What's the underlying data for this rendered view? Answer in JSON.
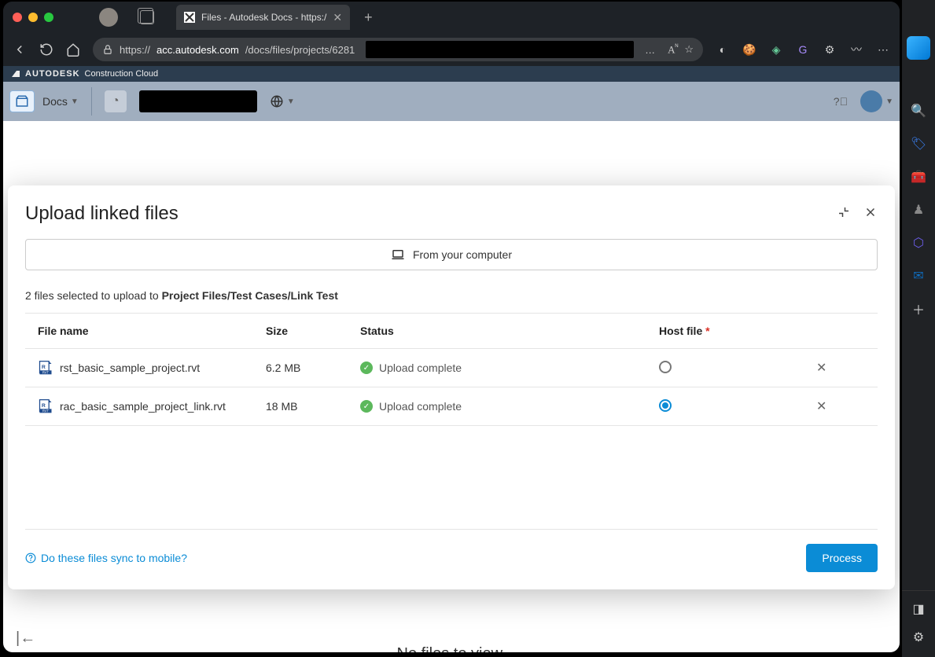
{
  "browser": {
    "tab_title": "Files - Autodesk Docs - https:/",
    "url_prefix": "https://",
    "url_bold": "acc.autodesk.com",
    "url_rest": "/docs/files/projects/6281"
  },
  "autodesk_bar": {
    "brand": "AUTODESK",
    "product": "Construction Cloud"
  },
  "docs_bar": {
    "label": "Docs"
  },
  "modal": {
    "title": "Upload linked files",
    "from_computer": "From your computer",
    "selected_prefix": "2 files selected to upload to ",
    "selected_path": "Project Files/Test Cases/Link Test",
    "columns": {
      "filename": "File name",
      "size": "Size",
      "status": "Status",
      "hostfile": "Host file",
      "required_mark": "*"
    },
    "rows": [
      {
        "name": "rst_basic_sample_project.rvt",
        "size": "6.2 MB",
        "status": "Upload complete",
        "host": false
      },
      {
        "name": "rac_basic_sample_project_link.rvt",
        "size": "18 MB",
        "status": "Upload complete",
        "host": true
      }
    ],
    "help_link": "Do these files sync to mobile?",
    "process": "Process"
  },
  "background": {
    "empty_text": "No files to view."
  }
}
